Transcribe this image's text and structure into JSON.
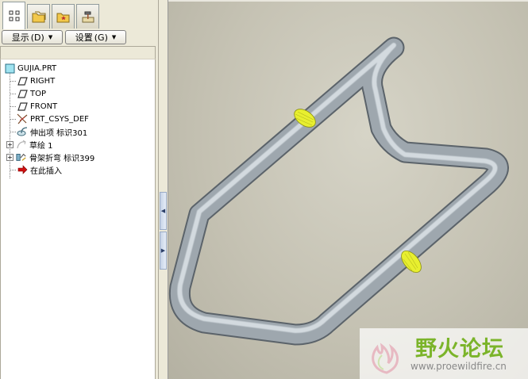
{
  "tabs": [
    {
      "name": "model-tree",
      "icon": "model-tree-icon",
      "active": true
    },
    {
      "name": "folder-browser",
      "icon": "folder-icon",
      "active": false
    },
    {
      "name": "favorites",
      "icon": "favorites-icon",
      "active": false
    },
    {
      "name": "connections",
      "icon": "hammer-icon",
      "active": false
    }
  ],
  "buttons": {
    "show_label": "显示",
    "show_key": "(D)",
    "settings_label": "设置",
    "settings_key": "(G)"
  },
  "tree": {
    "root": "GUJIA.PRT",
    "items": [
      {
        "label": "RIGHT",
        "icon": "datum-plane-icon"
      },
      {
        "label": "TOP",
        "icon": "datum-plane-icon"
      },
      {
        "label": "FRONT",
        "icon": "datum-plane-icon"
      },
      {
        "label": "PRT_CSYS_DEF",
        "icon": "csys-icon"
      },
      {
        "label": "伸出项 标识301",
        "icon": "protrusion-icon"
      },
      {
        "label": "草绘 1",
        "icon": "sketch-icon",
        "expandable": true
      },
      {
        "label": "骨架折弯 标识399",
        "icon": "spinal-bend-icon",
        "expandable": true
      },
      {
        "label": "在此插入",
        "icon": "insert-here-arrow-icon"
      }
    ]
  },
  "watermark": {
    "title": "野火论坛",
    "url": "www.proewildfire.cn"
  },
  "colors": {
    "tube": "#9ea7ae",
    "section_highlight": "#e8ef2f",
    "watermark_green": "#7bb42a",
    "insert_arrow": "#cc0000"
  }
}
